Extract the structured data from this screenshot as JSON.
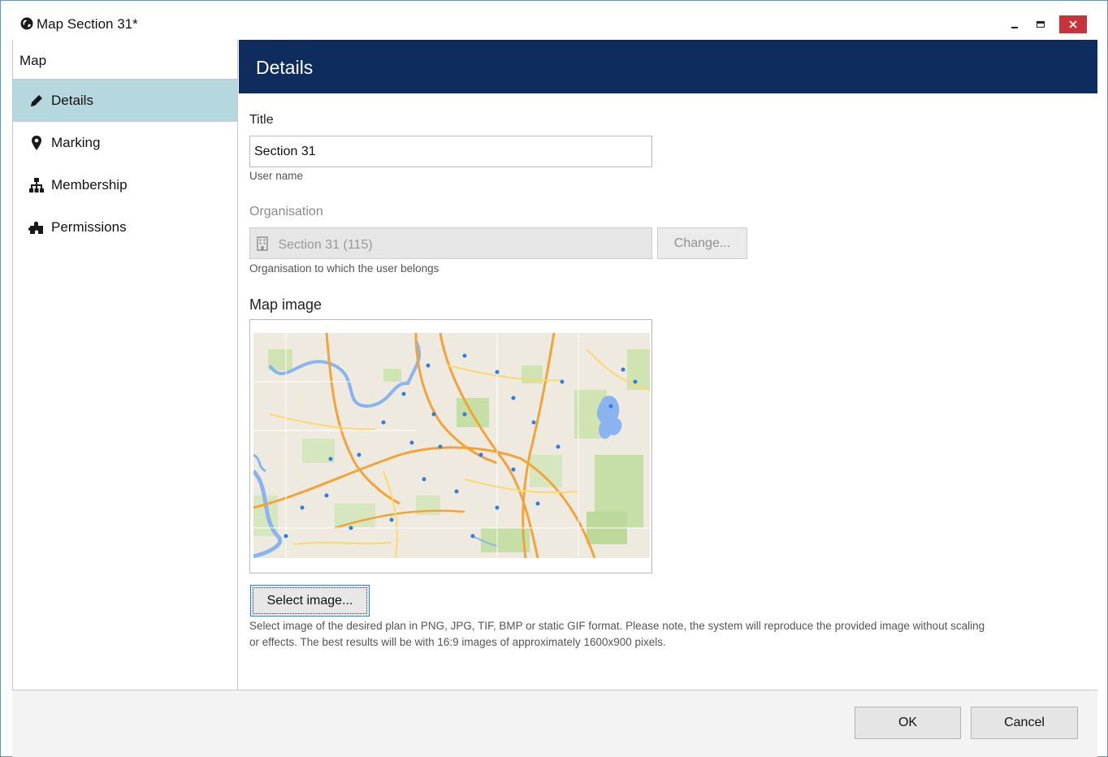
{
  "window": {
    "title": "Map Section 31*",
    "icon": "globe-icon",
    "close_color": "#c7333b"
  },
  "sidebar": {
    "header": "Map",
    "items": [
      {
        "label": "Details",
        "icon": "pencil-icon",
        "active": true
      },
      {
        "label": "Marking",
        "icon": "map-pin-icon",
        "active": false
      },
      {
        "label": "Membership",
        "icon": "hierarchy-icon",
        "active": false
      },
      {
        "label": "Permissions",
        "icon": "puzzle-icon",
        "active": false
      }
    ],
    "active_color": "#b5d8de"
  },
  "main": {
    "heading": "Details",
    "heading_bg": "#0e2d5e",
    "title_field": {
      "label": "Title",
      "value": "Section 31",
      "hint": "User name"
    },
    "organisation_field": {
      "label": "Organisation",
      "value": "Section 31 (115)",
      "icon": "building-icon",
      "change_label": "Change...",
      "hint": "Organisation to which the user belongs"
    },
    "map_image": {
      "label": "Map image",
      "select_label": "Select image...",
      "hint_line1": "Select image of the desired plan in PNG, JPG, TIF, BMP or static GIF format. Please note, the system will reproduce the provided image without scaling",
      "hint_line2": "or effects. The best results will be with 16:9 images of approximately 1600x900 pixels."
    }
  },
  "footer": {
    "ok_label": "OK",
    "cancel_label": "Cancel"
  }
}
